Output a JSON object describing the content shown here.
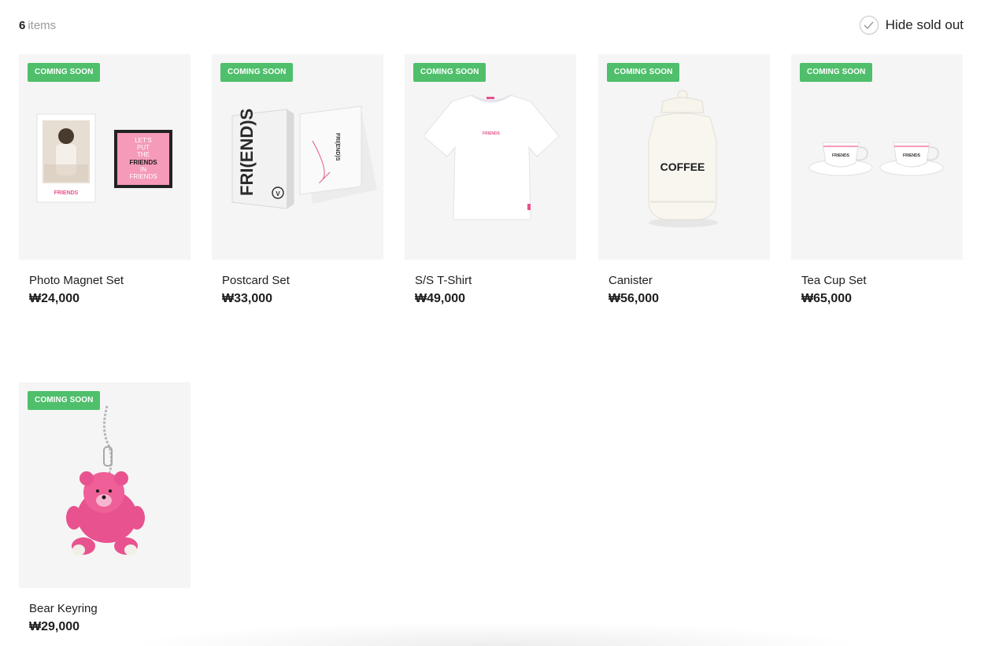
{
  "header": {
    "item_count": "6",
    "item_count_label": "items",
    "hide_sold_out_label": "Hide sold out"
  },
  "colors": {
    "badge_green": "#4fbf6b",
    "accent_pink": "#e8528f"
  },
  "products": [
    {
      "title": "Photo Magnet Set",
      "price": "₩24,000",
      "badge": "COMING SOON",
      "icon": "photo-magnet-image",
      "art_text": {
        "brand": "FRIENDS",
        "brand_caption": "FRIENDS",
        "slogan_1": "LET'S",
        "slogan_2": "PUT",
        "slogan_3": "THE",
        "slogan_4": "FRIENDS",
        "slogan_5": "IN",
        "slogan_6": "FRIENDS"
      }
    },
    {
      "title": "Postcard Set",
      "price": "₩33,000",
      "badge": "COMING SOON",
      "icon": "postcard-box-image",
      "art_text": {
        "box_title": "FRI(END)S",
        "box_mark": "V",
        "env_title": "FRI(END)S"
      }
    },
    {
      "title": "S/S T-Shirt",
      "price": "₩49,000",
      "badge": "COMING SOON",
      "icon": "tshirt-image",
      "art_text": {
        "chest": "FRIENDS"
      }
    },
    {
      "title": "Canister",
      "price": "₩56,000",
      "badge": "COMING SOON",
      "icon": "canister-image",
      "art_text": {
        "label": "COFFEE"
      }
    },
    {
      "title": "Tea Cup Set",
      "price": "₩65,000",
      "badge": "COMING SOON",
      "icon": "teacup-image",
      "art_text": {
        "cup": "FRIENDS"
      }
    },
    {
      "title": "Bear Keyring",
      "price": "₩29,000",
      "badge": "COMING SOON",
      "icon": "bear-keyring-image",
      "art_text": {}
    }
  ]
}
